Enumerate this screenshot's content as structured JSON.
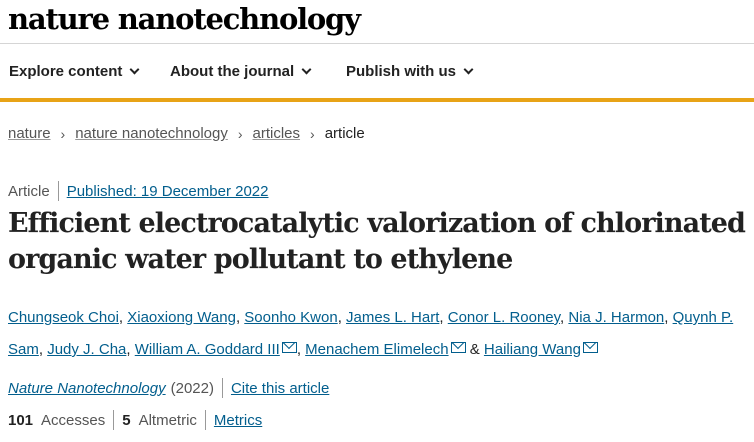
{
  "site": {
    "logo": "nature nanotechnology"
  },
  "nav": {
    "items": [
      {
        "label": "Explore content"
      },
      {
        "label": "About the journal"
      },
      {
        "label": "Publish with us"
      }
    ]
  },
  "breadcrumb": {
    "items": [
      "nature",
      "nature nanotechnology",
      "articles"
    ],
    "current": "article"
  },
  "article": {
    "type": "Article",
    "published": "Published: 19 December 2022",
    "title_line1": "Efficient electrocatalytic valorization of chlorinated",
    "title_line2": "organic water pollutant to ethylene",
    "authors": [
      "Chungseok Choi",
      "Xiaoxiong Wang",
      "Soonho Kwon",
      "James L. Hart",
      "Conor L. Rooney",
      "Nia J. Harmon",
      "Quynh P.",
      "Sam",
      "Judy J. Cha",
      "William A. Goddard III",
      "Menachem Elimelech",
      "Hailiang Wang"
    ],
    "authors_and": "&",
    "journal": "Nature Nanotechnology",
    "year": "(2022)",
    "cite": "Cite this article",
    "accesses_count": "101",
    "accesses_label": "Accesses",
    "altmetric_count": "5",
    "altmetric_label": "Altmetric",
    "metrics_link": "Metrics"
  }
}
